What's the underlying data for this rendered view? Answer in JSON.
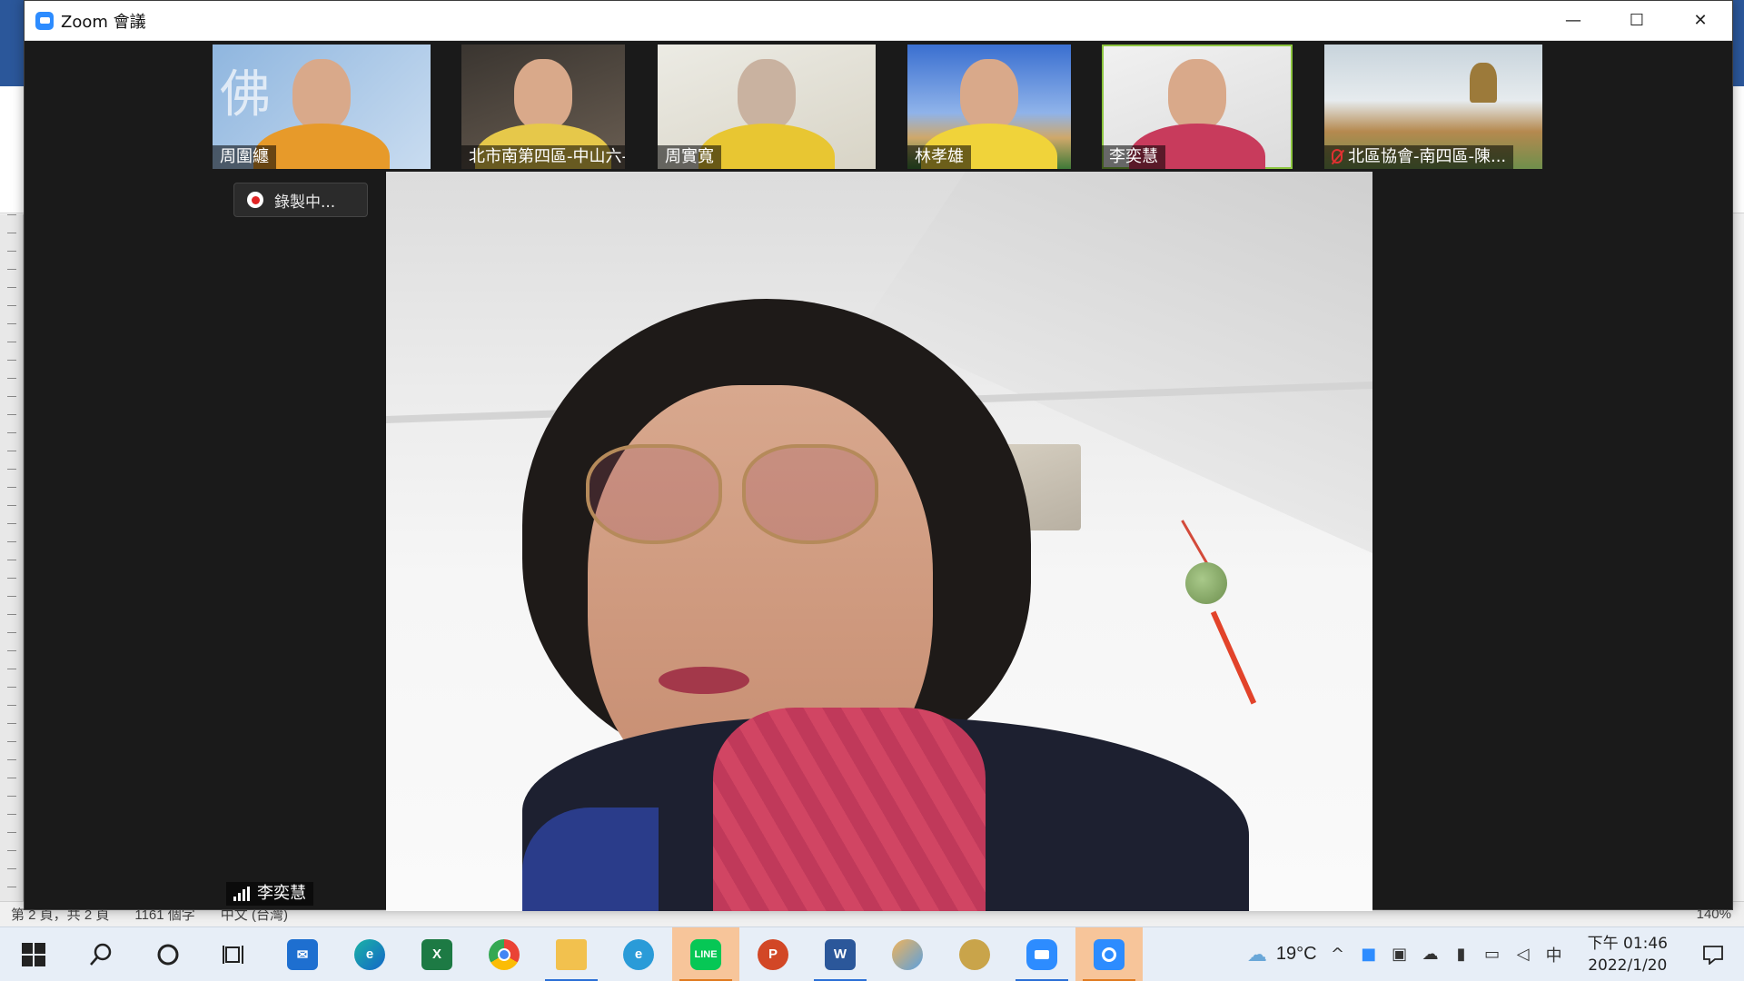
{
  "window": {
    "title": "Zoom 會議",
    "minimize_glyph": "—",
    "maximize_glyph": "☐",
    "close_glyph": "✕"
  },
  "gallery": {
    "tiles": [
      {
        "name": "周圍纏",
        "muted": false,
        "active": false
      },
      {
        "name": "北市南第四區-中山六-楊...",
        "muted": false,
        "active": false
      },
      {
        "name": "周實寬",
        "muted": false,
        "active": false
      },
      {
        "name": "林孝雄",
        "muted": false,
        "active": false
      },
      {
        "name": "李奕慧",
        "muted": false,
        "active": true
      },
      {
        "name": "北區協會-南四區-陳...",
        "muted": true,
        "active": false
      }
    ]
  },
  "recording": {
    "label": "錄製中..."
  },
  "speaker": {
    "name": "李奕慧"
  },
  "word_status": {
    "page": "第 2 頁，共 2 頁",
    "words": "1161 個字",
    "language": "中文 (台灣)",
    "zoom": "140%"
  },
  "taskbar": {
    "apps": [
      {
        "icon": "windows-start-icon",
        "running": false,
        "highlight": false
      },
      {
        "icon": "search-icon",
        "running": false,
        "highlight": false
      },
      {
        "icon": "cortana-icon",
        "running": false,
        "highlight": false
      },
      {
        "icon": "task-view-icon",
        "running": false,
        "highlight": false
      },
      {
        "icon": "mail-icon",
        "running": false,
        "highlight": false
      },
      {
        "icon": "edge-icon",
        "running": false,
        "highlight": false
      },
      {
        "icon": "excel-icon",
        "running": false,
        "highlight": false
      },
      {
        "icon": "chrome-icon",
        "running": false,
        "highlight": false
      },
      {
        "icon": "file-explorer-icon",
        "running": true,
        "highlight": false
      },
      {
        "icon": "internet-explorer-icon",
        "running": false,
        "highlight": false
      },
      {
        "icon": "line-icon",
        "running": true,
        "highlight": true
      },
      {
        "icon": "powerpoint-icon",
        "running": false,
        "highlight": false
      },
      {
        "icon": "word-icon",
        "running": true,
        "highlight": false
      },
      {
        "icon": "paint-icon",
        "running": false,
        "highlight": false
      },
      {
        "icon": "bird-app-icon",
        "running": false,
        "highlight": false
      },
      {
        "icon": "zoom-icon",
        "running": true,
        "highlight": false
      },
      {
        "icon": "zoom-meeting-icon",
        "running": true,
        "highlight": true
      }
    ],
    "weather": "19°C",
    "ime": "中",
    "time": "下午 01:46",
    "date": "2022/1/20"
  },
  "colors": {
    "zoom_blue": "#2d8cff",
    "active_speaker_border": "#8dc63f",
    "recording_red": "#e02424",
    "word_blue": "#2b579a"
  }
}
